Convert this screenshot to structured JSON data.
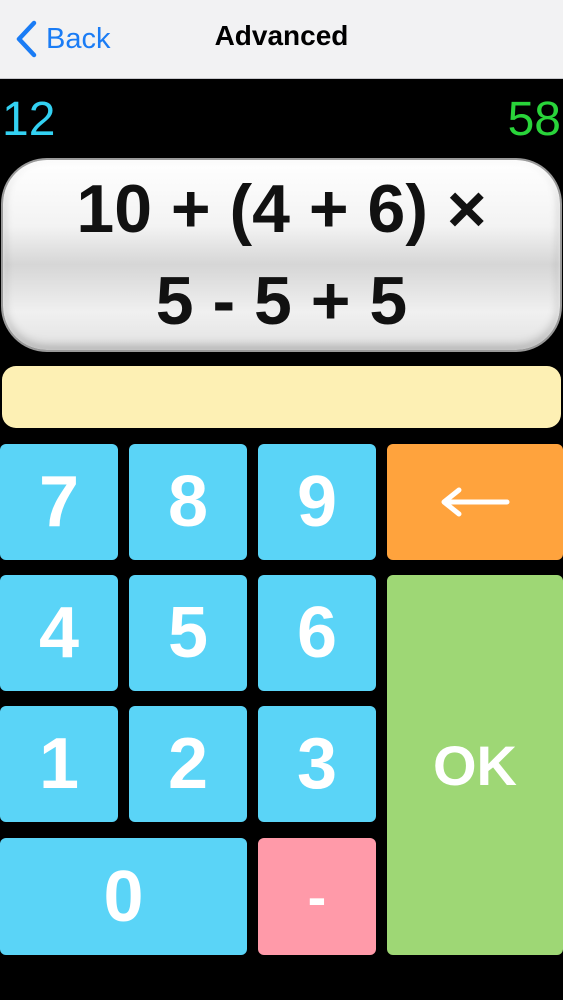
{
  "nav": {
    "back_label": "Back",
    "title": "Advanced",
    "accent": "#1a7cf5"
  },
  "scores": {
    "left": "12",
    "right": "58",
    "left_color": "#33d1f2",
    "right_color": "#29d43a"
  },
  "question": {
    "line1": "10 + (4 + 6) ×",
    "line2": "5 - 5 + 5"
  },
  "answer": {
    "value": ""
  },
  "keypad": {
    "k7": "7",
    "k8": "8",
    "k9": "9",
    "k4": "4",
    "k5": "5",
    "k6": "6",
    "k1": "1",
    "k2": "2",
    "k3": "3",
    "k0": "0",
    "minus": "-",
    "ok": "OK",
    "backspace_icon": "left-arrow-icon"
  },
  "colors": {
    "number_key": "#5ad4f7",
    "backspace_key": "#ffa33d",
    "ok_key": "#9ed775",
    "minus_key": "#ff9aa9",
    "answer_field": "#fdf0b4"
  }
}
